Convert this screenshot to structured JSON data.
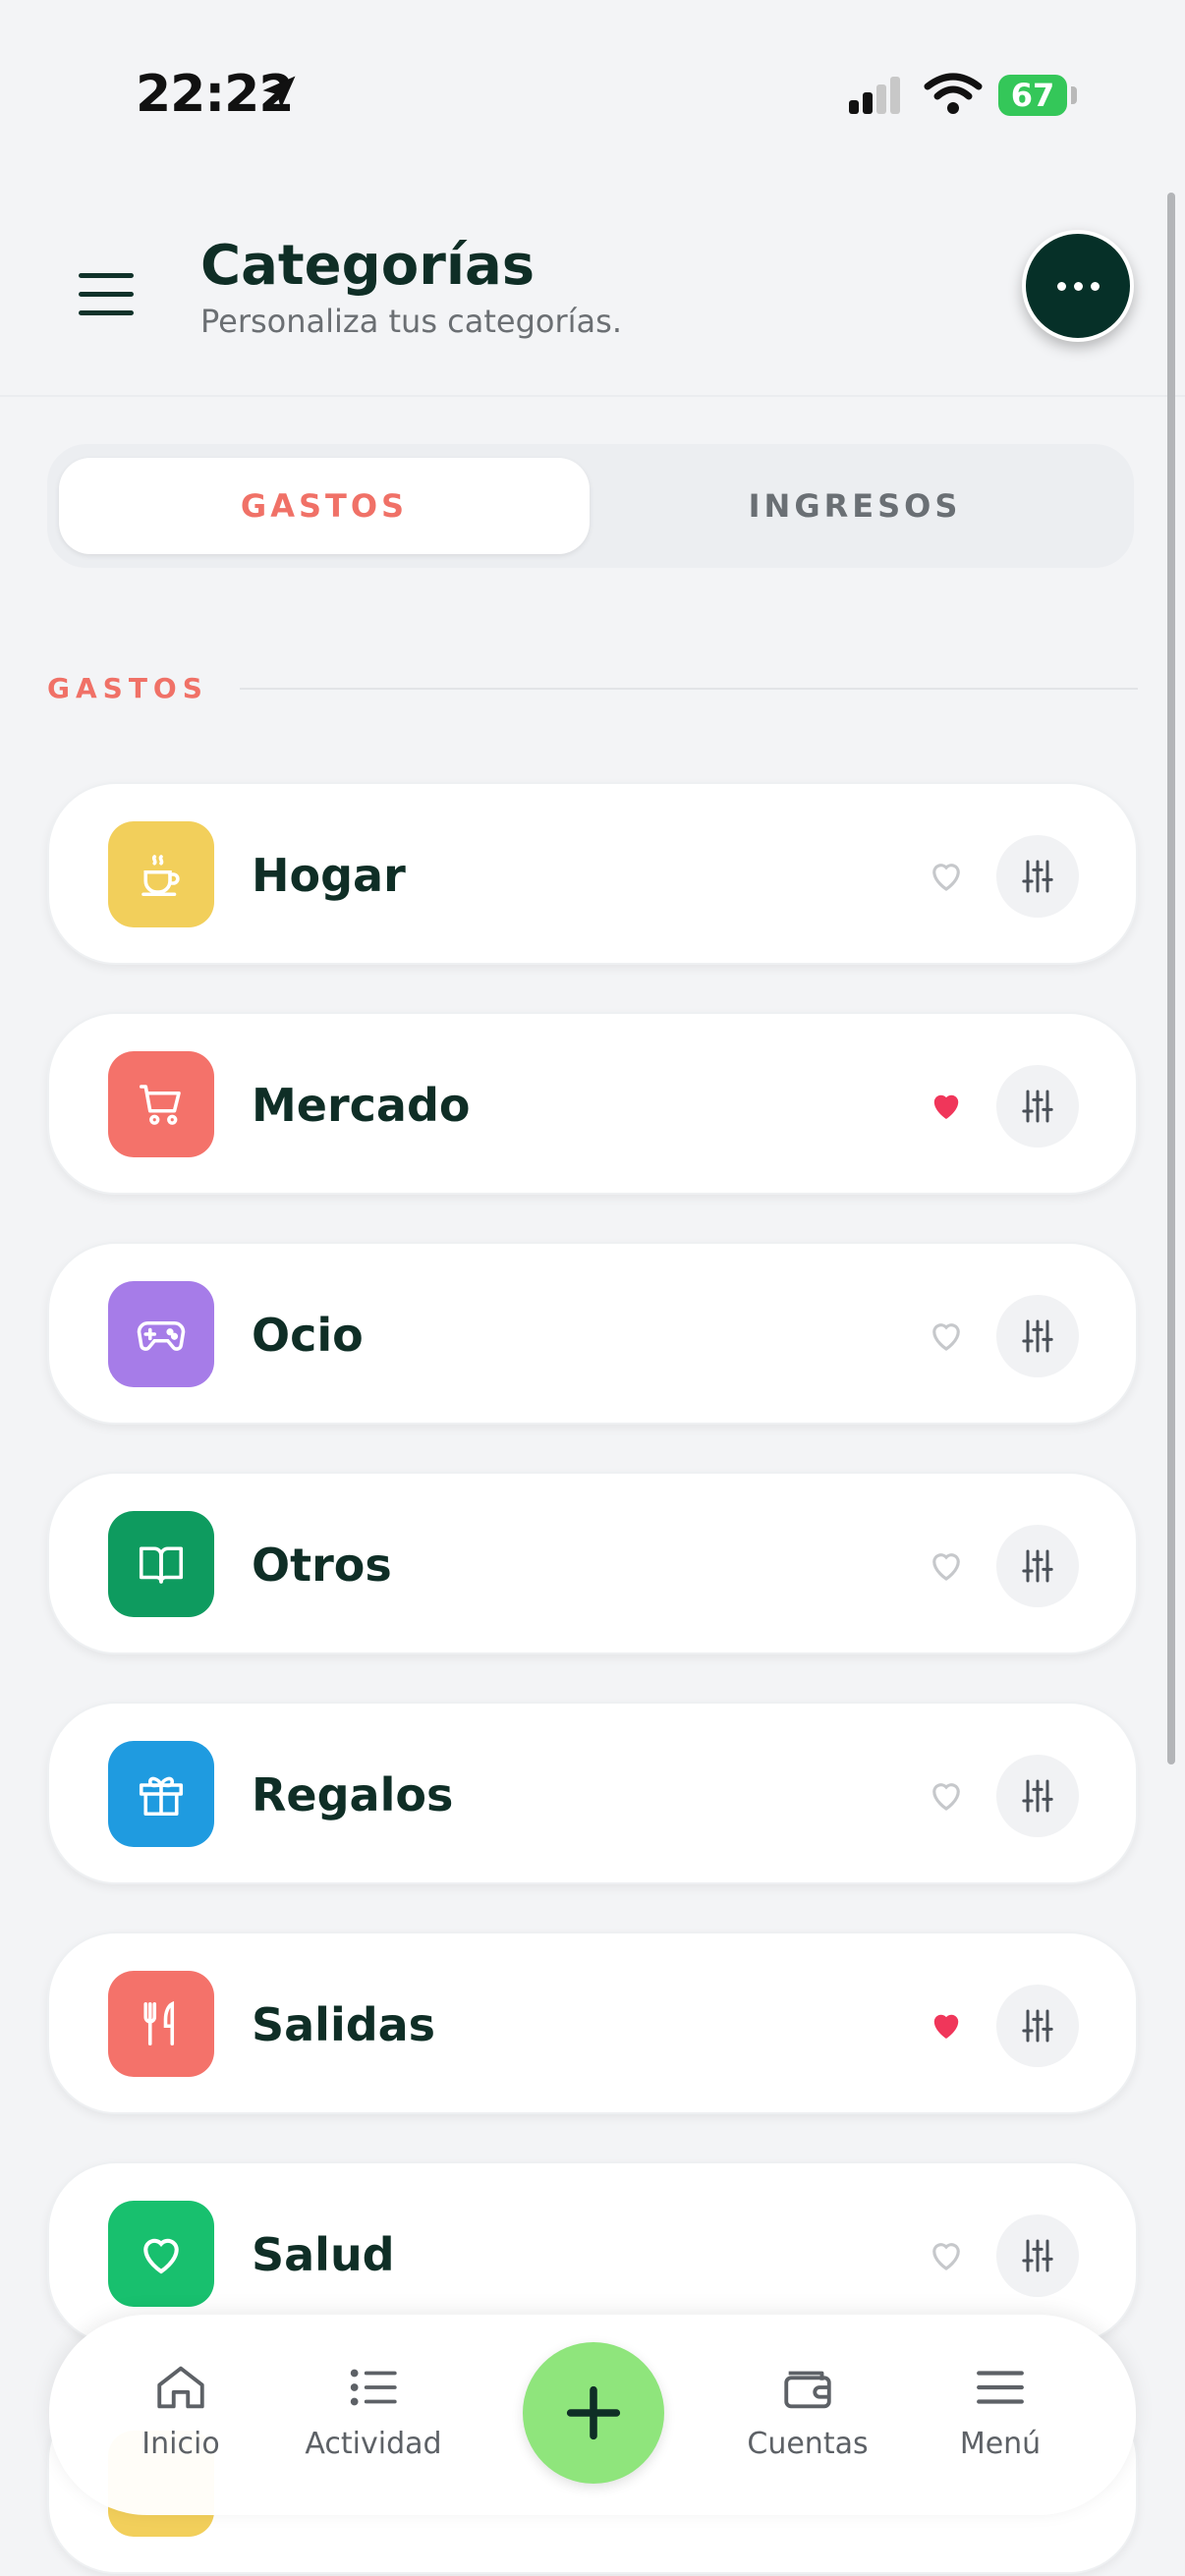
{
  "status_bar": {
    "time": "22:22",
    "battery": "67"
  },
  "header": {
    "title": "Categorías",
    "subtitle": "Personaliza tus categorías."
  },
  "tabs": {
    "active": "GASTOS",
    "inactive": "INGRESOS"
  },
  "section_label": "GASTOS",
  "categories": [
    {
      "label": "Hogar",
      "color": "#f2cf5b",
      "icon": "coffee-cup-icon",
      "favorite": false
    },
    {
      "label": "Mercado",
      "color": "#f4726a",
      "icon": "shopping-cart-icon",
      "favorite": true
    },
    {
      "label": "Ocio",
      "color": "#a67ce8",
      "icon": "gamepad-icon",
      "favorite": false
    },
    {
      "label": "Otros",
      "color": "#0e9b5f",
      "icon": "book-icon",
      "favorite": false
    },
    {
      "label": "Regalos",
      "color": "#1f9be0",
      "icon": "gift-icon",
      "favorite": false
    },
    {
      "label": "Salidas",
      "color": "#f4726a",
      "icon": "fork-knife-icon",
      "favorite": true
    },
    {
      "label": "Salud",
      "color": "#18c06e",
      "icon": "heart-outline-icon",
      "favorite": false
    }
  ],
  "bottom_nav": {
    "items": [
      {
        "label": "Inicio",
        "icon": "home-icon"
      },
      {
        "label": "Actividad",
        "icon": "list-icon"
      },
      {
        "label": "Cuentas",
        "icon": "wallet-icon"
      },
      {
        "label": "Menú",
        "icon": "menu-icon"
      }
    ],
    "fab_icon": "plus-icon"
  },
  "colors": {
    "accent": "#f07167",
    "dark": "#063028",
    "fab": "#8fe57c",
    "heart_active": "#f0365a"
  }
}
